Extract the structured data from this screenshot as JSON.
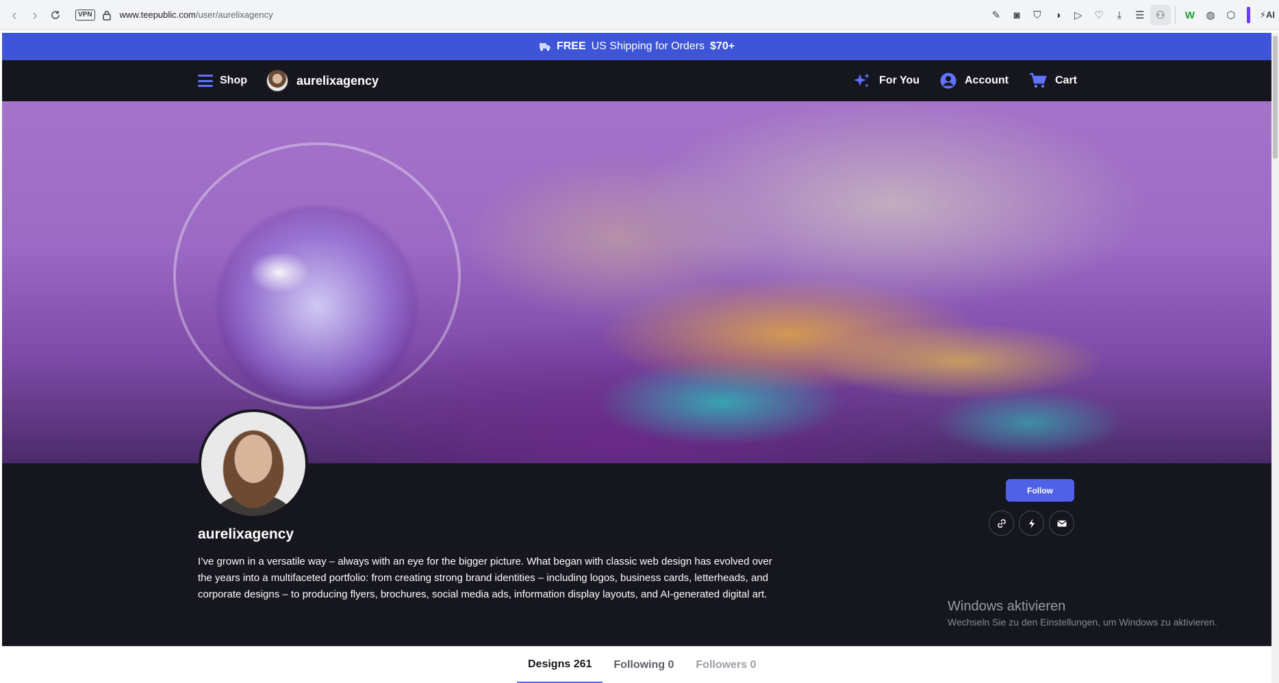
{
  "browser": {
    "url_host": "www.teepublic.com",
    "url_path": "/user/aurelixagency",
    "vpn_label": "VPN",
    "ai_label": "AI"
  },
  "promo": {
    "bold": "FREE",
    "text": "US Shipping for Orders",
    "amount": "$70+"
  },
  "nav": {
    "shop": "Shop",
    "store_name": "aurelixagency",
    "for_you": "For You",
    "account": "Account",
    "cart": "Cart"
  },
  "profile": {
    "name": "aurelixagency",
    "bio": "I’ve grown in a versatile way – always with an eye for the bigger picture. What began with classic web design has evolved over the years into a multifaceted portfolio: from creating strong brand identities – including logos, business cards, letterheads, and corporate designs – to producing flyers, brochures, social media ads, information display layouts, and AI-generated digital art.",
    "follow_label": "Follow"
  },
  "windows_watermark": {
    "title": "Windows aktivieren",
    "subtitle": "Wechseln Sie zu den Einstellungen, um Windows zu aktivieren."
  },
  "tabs": [
    {
      "label": "Designs 261"
    },
    {
      "label": "Following 0"
    },
    {
      "label": "Followers 0"
    }
  ],
  "colors": {
    "promo_bg": "#3d55d6",
    "nav_bg": "#16161f",
    "accent": "#4f62e6"
  }
}
